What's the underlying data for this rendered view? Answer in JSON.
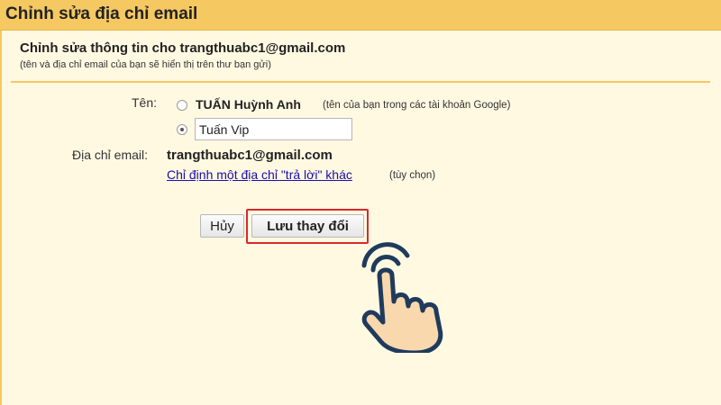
{
  "window": {
    "title": "Chỉnh sửa địa chỉ email"
  },
  "form": {
    "heading": "Chỉnh sửa thông tin cho trangthuabc1@gmail.com",
    "subheading": "(tên và địa chỉ email của bạn sẽ hiển thị trên thư bạn gửi)",
    "name_label": "Tên:",
    "name_option_google": "TUẤN Huỳnh Anh",
    "name_option_google_hint": "(tên của bạn trong các tài khoản Google)",
    "name_custom_value": "Tuấn Vip",
    "email_label": "Địa chỉ email:",
    "email_value": "trangthuabc1@gmail.com",
    "reply_link": "Chỉ định một địa chỉ \"trả lời\" khác",
    "reply_optional": "(tùy chọn)"
  },
  "buttons": {
    "cancel": "Hủy",
    "save": "Lưu thay đổi"
  },
  "colors": {
    "header": "#f5c862",
    "background": "#fff9e2",
    "highlight": "#d9282d",
    "link": "#1a0dab"
  },
  "icons": {
    "pointer": "hand-pointer-icon"
  }
}
